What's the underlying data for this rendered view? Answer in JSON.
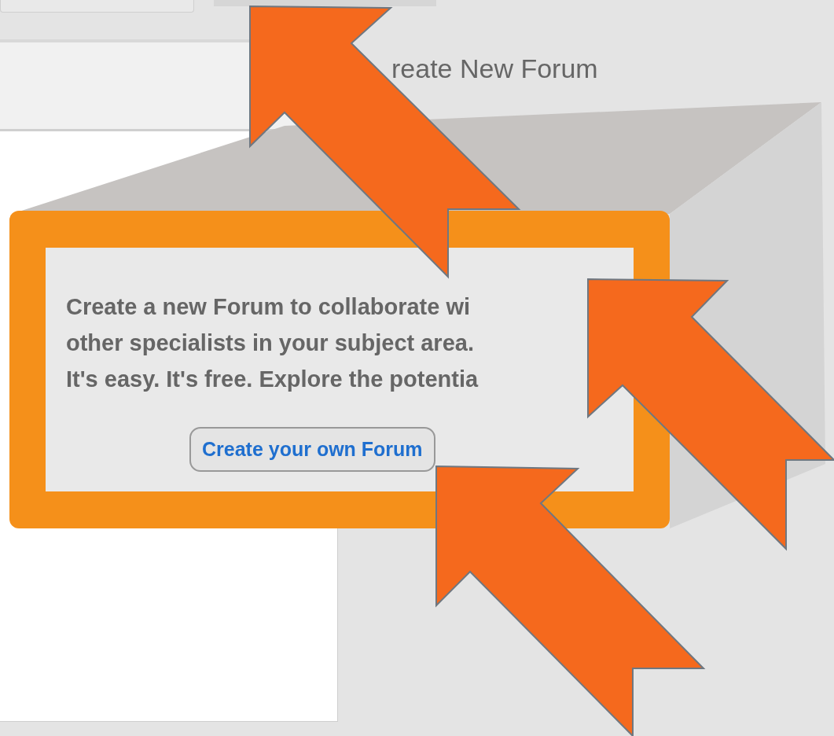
{
  "heading": "reate New Forum",
  "promo": {
    "lines": [
      "Create a new Forum to collaborate wi",
      "other specialists in your subject area.",
      "It's easy. It's free. Explore the potentia"
    ],
    "button": "Create your own Forum"
  }
}
